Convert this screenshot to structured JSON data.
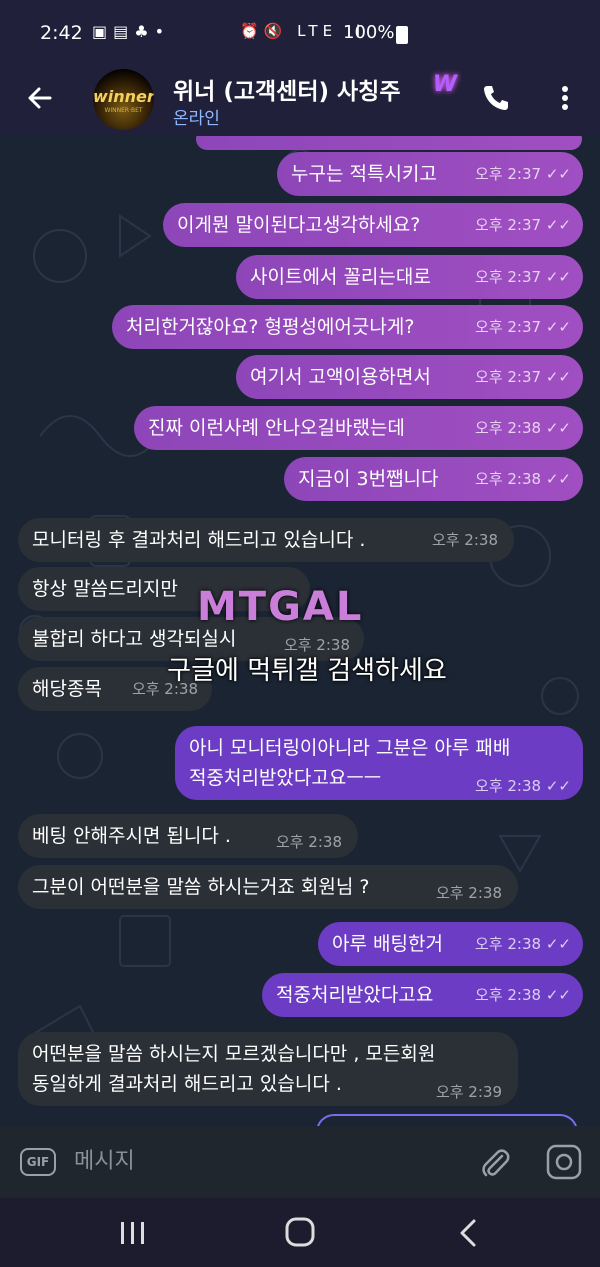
{
  "status_bar": {
    "time": "2:42",
    "left_icons": "▣▤♣•",
    "right_icons": "⏰🔇 LTE ıl",
    "battery": "100%"
  },
  "header": {
    "title": "위너 (고객센터) 사칭주",
    "badge": "W",
    "status": "온라인",
    "avatar_text": "winner",
    "avatar_sub": "WINNER·BET"
  },
  "messages": [
    {
      "dir": "out",
      "text": "누구는 적특시키고",
      "time": "오후 2:37"
    },
    {
      "dir": "out",
      "text": "이게뭔 말이된다고생각하세요?",
      "time": "오후 2:37"
    },
    {
      "dir": "out",
      "text": "사이트에서 꼴리는대로",
      "time": "오후 2:37"
    },
    {
      "dir": "out",
      "text": "처리한거잖아요? 형평성에어긋나게?",
      "time": "오후 2:37"
    },
    {
      "dir": "out",
      "text": "여기서 고액이용하면서",
      "time": "오후 2:37"
    },
    {
      "dir": "out",
      "text": "진짜 이런사례 안나오길바랬는데",
      "time": "오후 2:38"
    },
    {
      "dir": "out",
      "text": "지금이 3번쨉니다",
      "time": "오후 2:38"
    },
    {
      "dir": "in",
      "text": "모니터링 후 결과처리 해드리고 있습니다 .",
      "time": "오후 2:38"
    },
    {
      "dir": "in",
      "text": "항상 말씀드리지만",
      "time": ""
    },
    {
      "dir": "in",
      "text": "불합리 하다고 생각되실시",
      "time": "오후 2:38"
    },
    {
      "dir": "in",
      "text": "해당종목",
      "time": "오후 2:38"
    },
    {
      "dir": "out",
      "line1": "아니 모니터링이아니라 그분은 아루 패배",
      "line2": "적중처리받았다고요ㅡㅡ",
      "time": "오후 2:38"
    },
    {
      "dir": "in",
      "text": "베팅 안해주시면 됩니다 .",
      "time": "오후 2:38"
    },
    {
      "dir": "in",
      "text": "그분이 어떤분을 말씀 하시는거죠 회원님 ?",
      "time": "오후 2:38"
    },
    {
      "dir": "out",
      "text": "아루 배팅한거",
      "time": "오후 2:38"
    },
    {
      "dir": "out",
      "text": "적중처리받았다고요",
      "time": "오후 2:38"
    },
    {
      "dir": "in",
      "line1": "어떤분을 말씀 하시는지 모르겠습니다만 , 모든회원",
      "line2": "동일하게 결과처리 해드리고 있습니다 .",
      "time": "오후 2:39"
    }
  ],
  "read_ticks": "✓✓",
  "watermark": {
    "logo": "MTGAL",
    "text": "구글에 먹튀갤 검색하세요"
  },
  "input": {
    "gif_label": "GIF",
    "placeholder": "메시지"
  },
  "colors": {
    "outgoing_bubble": "#9a4cc0",
    "incoming_bubble": "#2b3036",
    "header_bg": "#20203a",
    "online_status": "#8fb8ff"
  }
}
